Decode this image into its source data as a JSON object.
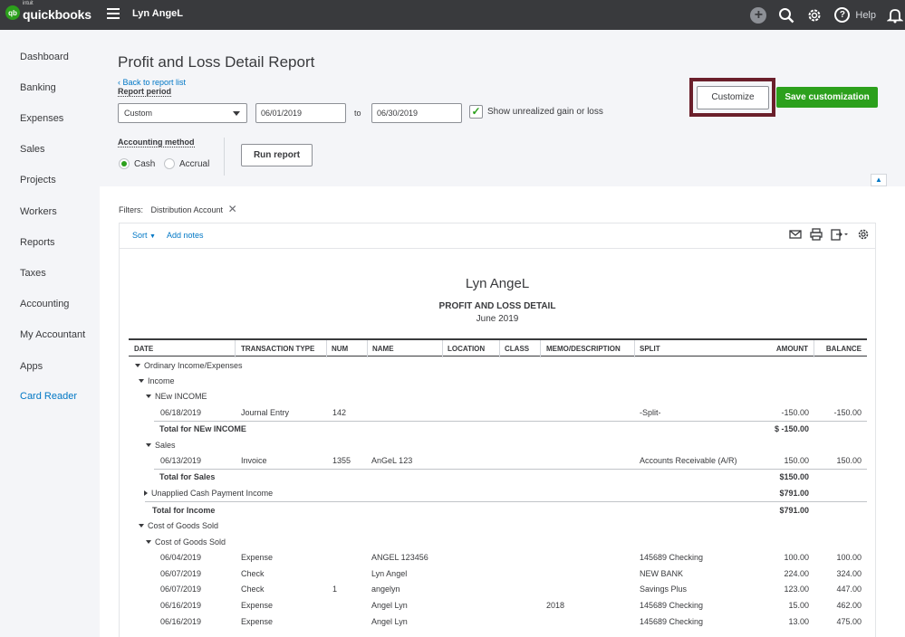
{
  "topbar": {
    "logo_mark": "qb",
    "logo_brand": "intuit",
    "logo_name": "quickbooks",
    "company": "Lyn AngeL",
    "help_label": "Help",
    "icons": [
      "plus-icon",
      "search-icon",
      "gear-icon",
      "help-icon",
      "bell-icon"
    ]
  },
  "sidebar": {
    "items": [
      "Dashboard",
      "Banking",
      "Expenses",
      "Sales",
      "Projects",
      "Workers",
      "Reports",
      "Taxes",
      "Accounting",
      "My Accountant",
      "Apps",
      "Card Reader"
    ]
  },
  "header": {
    "title": "Profit and Loss Detail Report",
    "back_link": "Back to report list",
    "period_label": "Report period",
    "period_value": "Custom",
    "from_date": "06/01/2019",
    "to_label": "to",
    "to_date": "06/30/2019",
    "unrealized_label": "Show unrealized gain or loss",
    "unrealized_checked": true,
    "method_label": "Accounting method",
    "method_cash": "Cash",
    "method_accrual": "Accrual",
    "selected_method": "Cash",
    "run_report": "Run report",
    "customize": "Customize",
    "save_customization": "Save customization"
  },
  "filters": {
    "label": "Filters:",
    "value": "Distribution Account"
  },
  "toolbar": {
    "sort": "Sort",
    "add_notes": "Add notes",
    "icons": [
      "email-icon",
      "print-icon",
      "export-icon",
      "settings-icon"
    ]
  },
  "report": {
    "company": "Lyn AngeL",
    "title": "PROFIT AND LOSS DETAIL",
    "date": "June 2019",
    "columns": [
      "DATE",
      "TRANSACTION TYPE",
      "NUM",
      "NAME",
      "LOCATION",
      "CLASS",
      "MEMO/DESCRIPTION",
      "SPLIT",
      "AMOUNT",
      "BALANCE"
    ],
    "sections": {
      "ordinary": "Ordinary Income/Expenses",
      "income": "Income",
      "new_income": "NEw INCOME",
      "total_new_income": "Total for NEw INCOME",
      "total_new_income_amount": "$ -150.00",
      "sales": "Sales",
      "total_sales": "Total for Sales",
      "total_sales_amount": "$150.00",
      "unapplied": "Unapplied Cash Payment Income",
      "unapplied_amount": "$791.00",
      "total_income": "Total for Income",
      "total_income_amount": "$791.00",
      "cogs": "Cost of Goods Sold",
      "cogs_sub": "Cost of Goods Sold"
    },
    "new_income_rows": [
      {
        "date": "06/18/2019",
        "type": "Journal Entry",
        "num": "142",
        "name": "",
        "location": "",
        "class": "",
        "memo": "",
        "split": "-Split-",
        "amount": "-150.00",
        "balance": "-150.00"
      }
    ],
    "sales_rows": [
      {
        "date": "06/13/2019",
        "type": "Invoice",
        "num": "1355",
        "name": "AnGeL 123",
        "location": "",
        "class": "",
        "memo": "",
        "split": "Accounts Receivable (A/R)",
        "amount": "150.00",
        "balance": "150.00"
      }
    ],
    "cogs_rows": [
      {
        "date": "06/04/2019",
        "type": "Expense",
        "num": "",
        "name": "ANGEL 123456",
        "location": "",
        "class": "",
        "memo": "",
        "split": "145689 Checking",
        "amount": "100.00",
        "balance": "100.00"
      },
      {
        "date": "06/07/2019",
        "type": "Check",
        "num": "",
        "name": "Lyn Angel",
        "location": "",
        "class": "",
        "memo": "",
        "split": "NEW BANK",
        "amount": "224.00",
        "balance": "324.00"
      },
      {
        "date": "06/07/2019",
        "type": "Check",
        "num": "1",
        "name": "angelyn",
        "location": "",
        "class": "",
        "memo": "",
        "split": "Savings Plus",
        "amount": "123.00",
        "balance": "447.00"
      },
      {
        "date": "06/16/2019",
        "type": "Expense",
        "num": "",
        "name": "Angel Lyn",
        "location": "",
        "class": "",
        "memo": "2018",
        "split": "145689 Checking",
        "amount": "15.00",
        "balance": "462.00"
      },
      {
        "date": "06/16/2019",
        "type": "Expense",
        "num": "",
        "name": "Angel Lyn",
        "location": "",
        "class": "",
        "memo": "",
        "split": "145689 Checking",
        "amount": "13.00",
        "balance": "475.00"
      }
    ]
  }
}
